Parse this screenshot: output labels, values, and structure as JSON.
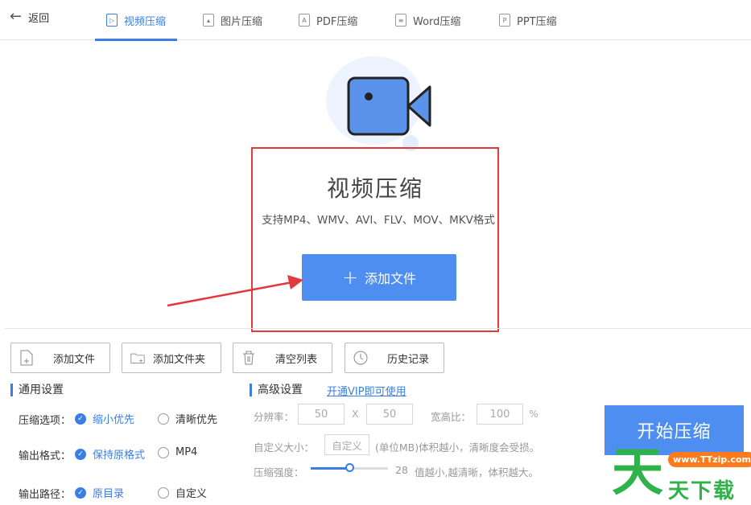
{
  "nav": {
    "back_label": "返回",
    "tabs": [
      {
        "label": "视频压缩",
        "icon": "play-doc-icon",
        "active": true
      },
      {
        "label": "图片压缩",
        "icon": "image-doc-icon",
        "active": false
      },
      {
        "label": "PDF压缩",
        "icon": "pdf-doc-icon",
        "active": false
      },
      {
        "label": "Word压缩",
        "icon": "word-doc-icon",
        "active": false
      },
      {
        "label": "PPT压缩",
        "icon": "ppt-doc-icon",
        "active": false
      }
    ]
  },
  "hero": {
    "title": "视频压缩",
    "subtitle": "支持MP4、WMV、AVI、FLV、MOV、MKV格式",
    "add_button": "添加文件"
  },
  "toolbar": {
    "add_file": "添加文件",
    "add_folder": "添加文件夹",
    "clear_list": "清空列表",
    "history": "历史记录"
  },
  "general": {
    "title": "通用设置",
    "compress_label": "压缩选项：",
    "compress_opt1": "缩小优先",
    "compress_opt2": "清晰优先",
    "format_label": "输出格式：",
    "format_opt1": "保持原格式",
    "format_opt2": "MP4",
    "path_label": "输出路径：",
    "path_opt1": "原目录",
    "path_opt2": "自定义"
  },
  "advanced": {
    "title": "高级设置",
    "vip_link": "开通VIP即可使用",
    "resolution_label": "分辨率：",
    "width": "50",
    "x_sep": "X",
    "height": "50",
    "ratio_label": "宽高比：",
    "ratio": "100",
    "ratio_unit": "%",
    "size_label": "自定义大小：",
    "size_value": "自定义",
    "size_hint": "(单位MB)体积越小，清晰度会受损。",
    "strength_label": "压缩强度：",
    "strength_value": "28",
    "strength_fraction": 0.5,
    "strength_hint": "值越小,越清晰，体积越大。"
  },
  "start_button": "开始压缩",
  "watermark": {
    "big": "天",
    "url": "www.TTzip.com",
    "text": "天下载"
  },
  "colors": {
    "accent": "#3a7ee6",
    "button": "#4d8ef0",
    "highlight_box": "#e0393e",
    "watermark_green": "#2fb24a"
  }
}
